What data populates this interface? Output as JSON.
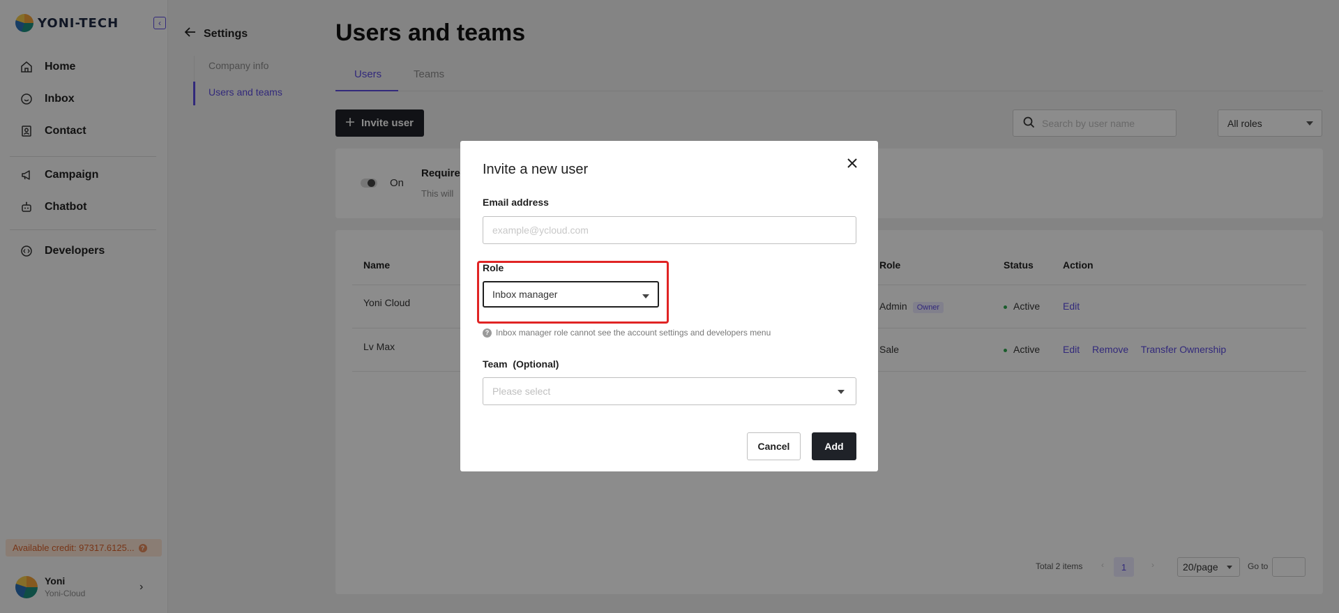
{
  "brand": {
    "name": "YONI-TECH"
  },
  "nav": {
    "items": [
      {
        "label": "Home",
        "icon": "home-icon"
      },
      {
        "label": "Inbox",
        "icon": "inbox-icon"
      },
      {
        "label": "Contact",
        "icon": "contact-icon"
      },
      {
        "label": "Campaign",
        "icon": "megaphone-icon"
      },
      {
        "label": "Chatbot",
        "icon": "robot-icon"
      },
      {
        "label": "Developers",
        "icon": "code-icon"
      }
    ],
    "credit": "Available credit: 97317.6125...",
    "user": {
      "name": "Yoni",
      "org": "Yoni-Cloud"
    }
  },
  "settings": {
    "back_label": "Settings",
    "items": [
      {
        "label": "Company info",
        "active": false
      },
      {
        "label": "Users and teams",
        "active": true
      }
    ]
  },
  "main": {
    "title": "Users and teams",
    "tabs": [
      {
        "label": "Users",
        "active": true
      },
      {
        "label": "Teams",
        "active": false
      }
    ],
    "invite_label": "Invite user",
    "search_placeholder": "Search by user name",
    "roles_filter": "All roles",
    "two_fa": {
      "toggle_label": "On",
      "title": "Require",
      "desc": "This will"
    },
    "table": {
      "columns": [
        "Name",
        "Role",
        "Status",
        "Action"
      ],
      "rows": [
        {
          "name": "Yoni Cloud",
          "role": "Admin",
          "tag": "Owner",
          "status": "Active",
          "actions": [
            "Edit"
          ]
        },
        {
          "name": "Lv Max",
          "role": "Sale",
          "tag": "",
          "status": "Active",
          "actions": [
            "Edit",
            "Remove",
            "Transfer Ownership"
          ]
        }
      ]
    },
    "pagination": {
      "total": "Total 2 items",
      "page": "1",
      "page_size": "20/page",
      "goto_label": "Go to"
    }
  },
  "modal": {
    "title": "Invite a new user",
    "email_label": "Email address",
    "email_placeholder": "example@ycloud.com",
    "role_label": "Role",
    "role_value": "Inbox manager",
    "role_hint": "Inbox manager role cannot see the account settings and developers menu",
    "team_label": "Team  (Optional)",
    "team_placeholder": "Please select",
    "cancel_label": "Cancel",
    "add_label": "Add"
  },
  "colors": {
    "accent": "#5b4ce0",
    "dark": "#1f2228",
    "highlight": "#e02424",
    "credit_text": "#d9622b",
    "status_active": "#2fa84f"
  }
}
